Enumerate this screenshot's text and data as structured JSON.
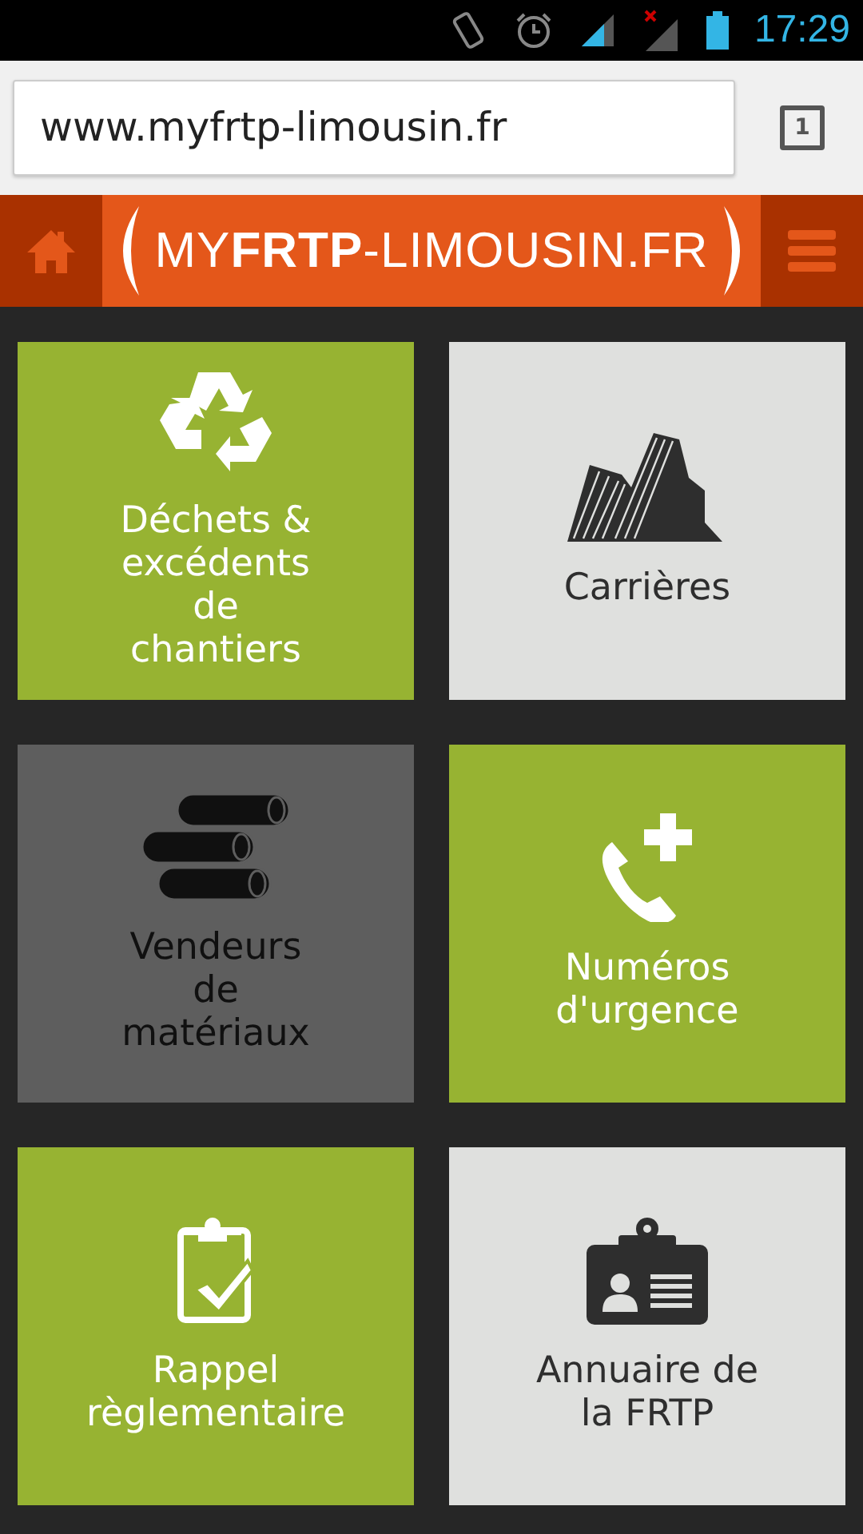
{
  "status_bar": {
    "time": "17:29"
  },
  "browser": {
    "url": "www.myfrtp-limousin.fr",
    "tab_count": "1"
  },
  "header": {
    "logo": "MY**FRTP**-LIMOUSIN.FR"
  },
  "tiles": [
    {
      "label": "Déchets &\nexcédents\nde\nchantiers",
      "color": "#97b332"
    },
    {
      "label": "Carrières",
      "color": "#dfe0de"
    },
    {
      "label": "Vendeurs\nde\nmatériaux",
      "color": "#5e5e5e"
    },
    {
      "label": "Numéros\nd'urgence",
      "color": "#97b332"
    },
    {
      "label": "Rappel\nrèglementaire",
      "color": "#97b332"
    },
    {
      "label": "Annuaire de\nla FRTP",
      "color": "#dfe0de"
    }
  ]
}
